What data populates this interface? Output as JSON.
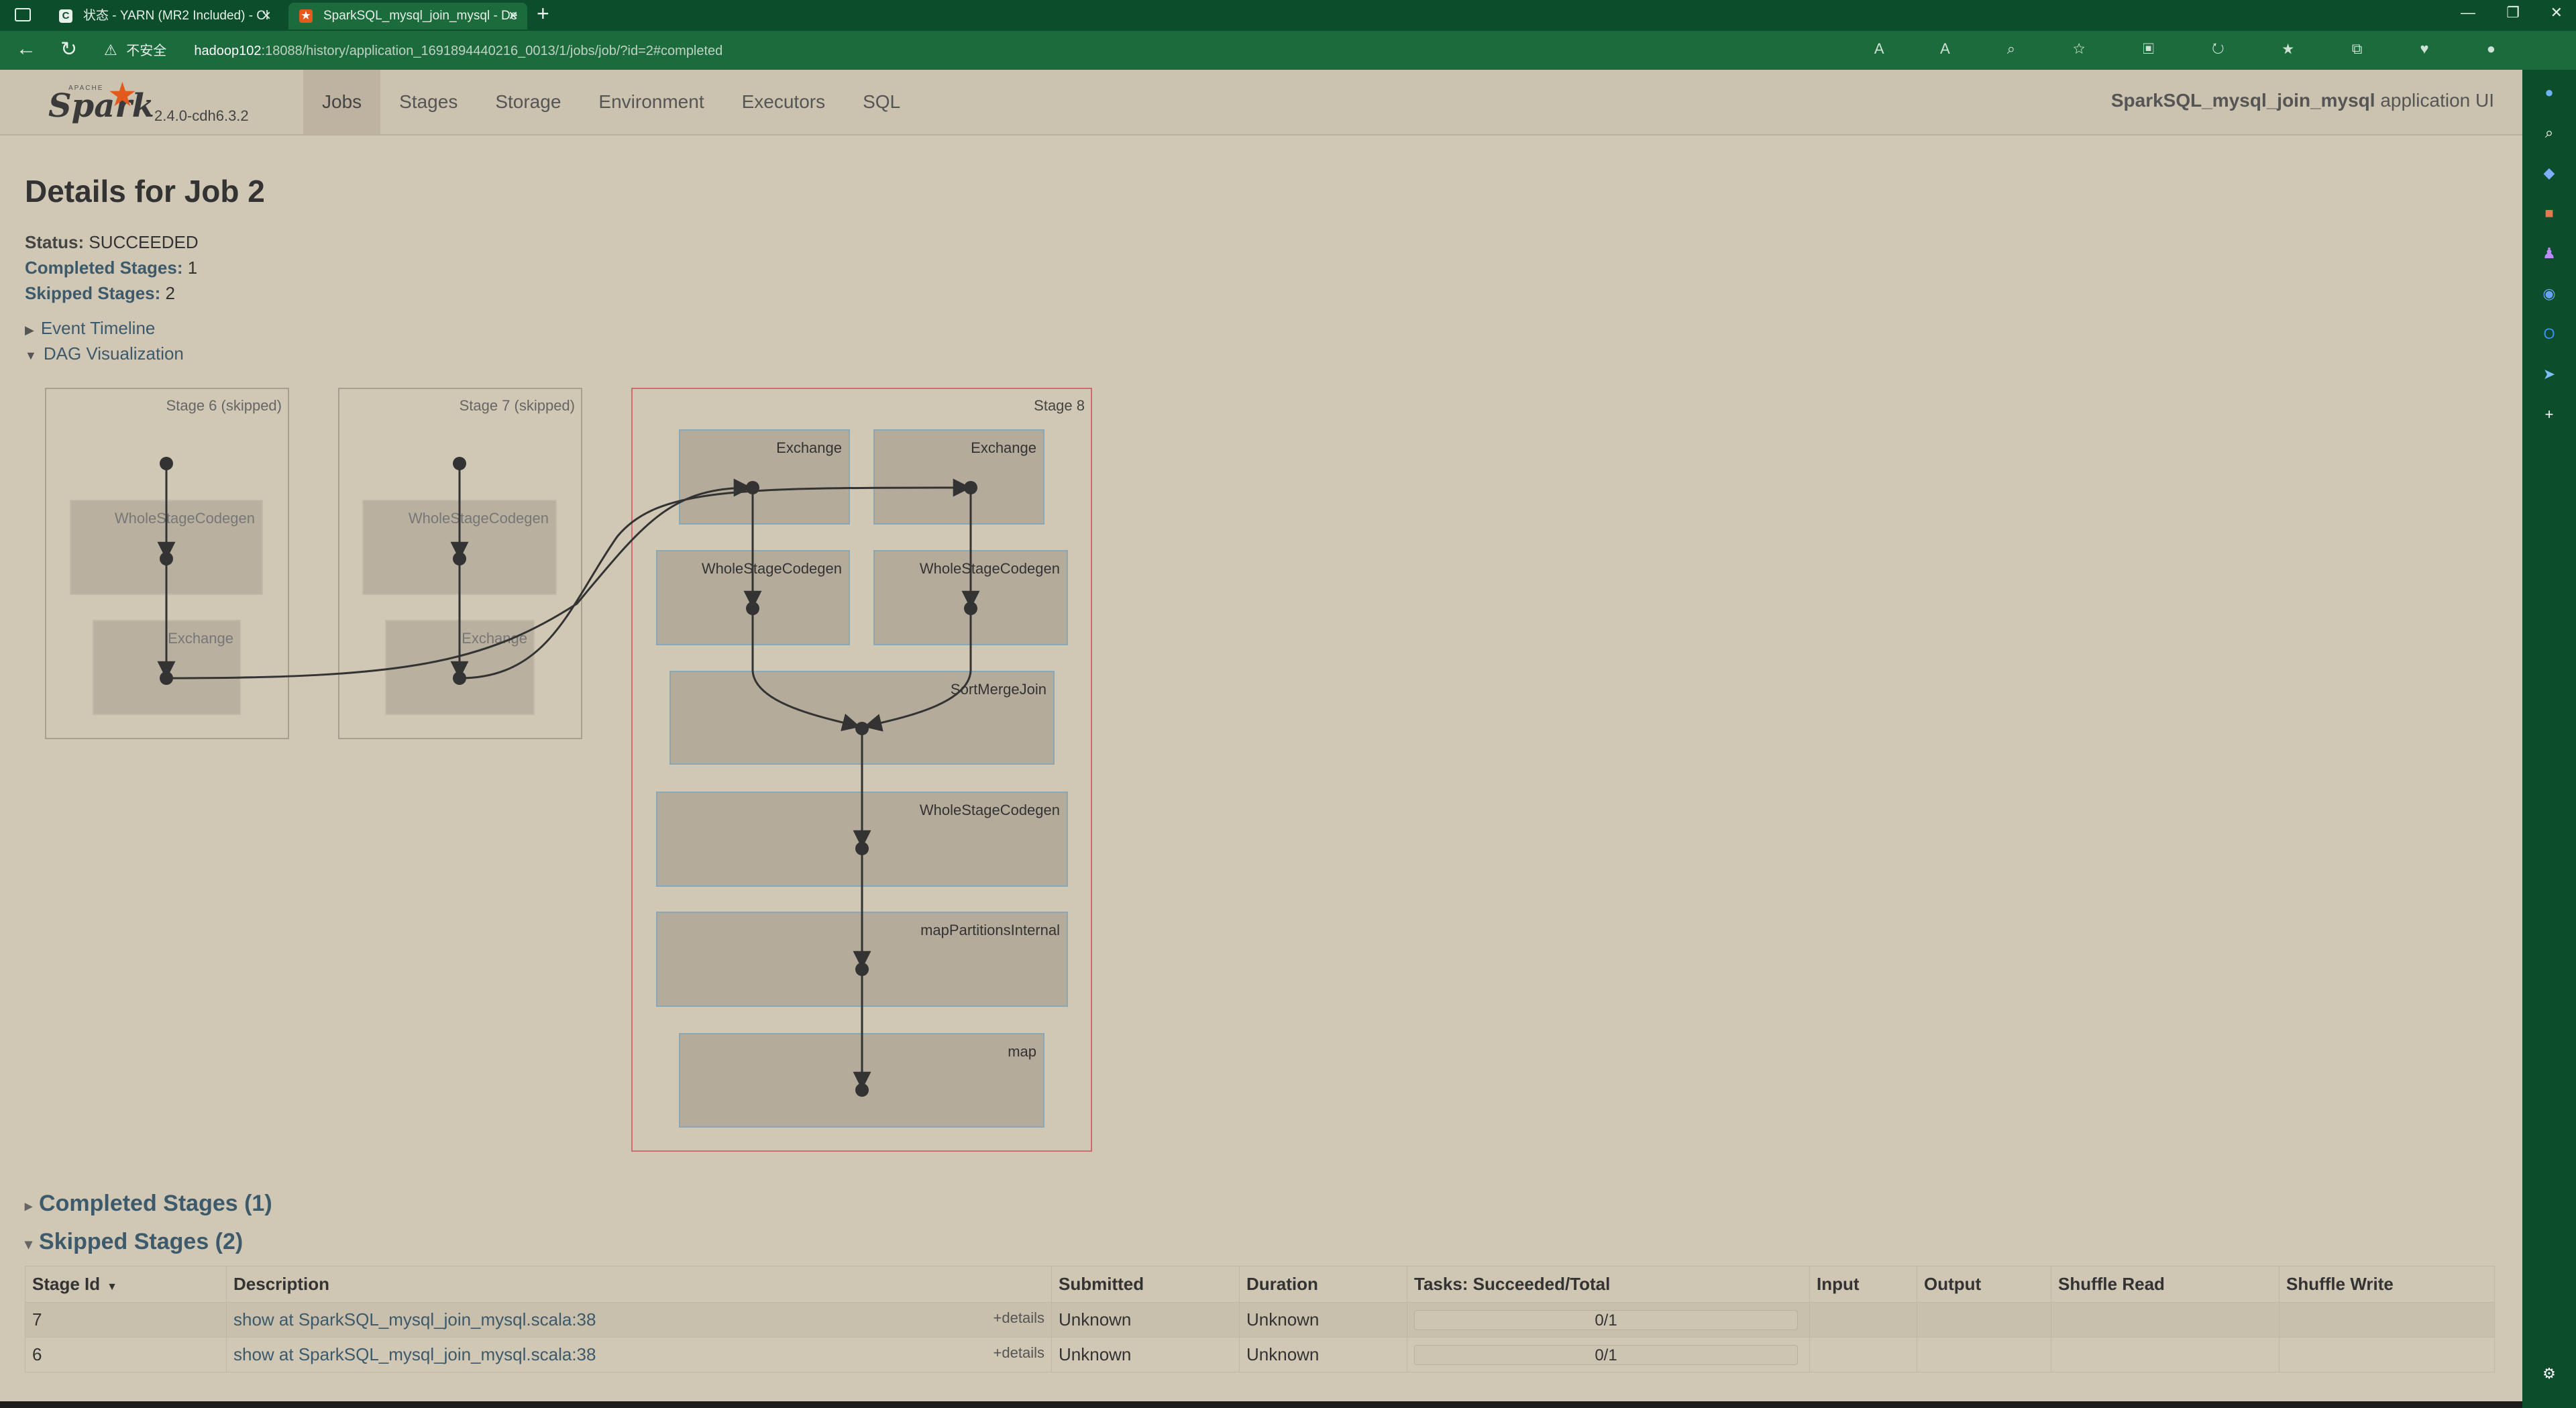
{
  "browser": {
    "tabs": [
      {
        "label": "状态 - YARN (MR2 Included) - Cl",
        "favicon": "C"
      },
      {
        "label": "SparkSQL_mysql_join_mysql - De",
        "favicon": "spark"
      }
    ],
    "new_tab": "+",
    "url": {
      "security": "不安全",
      "host": "hadoop102",
      "path": ":18088/history/application_1691894440216_0013/1/jobs/job/?id=2#completed"
    }
  },
  "spark_nav": {
    "logo_word": "Spark",
    "logo_apache": "APACHE",
    "version": "2.4.0-cdh6.3.2",
    "tabs": [
      "Jobs",
      "Stages",
      "Storage",
      "Environment",
      "Executors",
      "SQL"
    ],
    "active_tab": "Jobs",
    "app_name": "SparkSQL_mysql_join_mysql",
    "app_suffix": " application UI"
  },
  "job": {
    "title": "Details for Job 2",
    "status_label": "Status:",
    "status_value": "SUCCEEDED",
    "completed_label": "Completed Stages:",
    "completed_value": "1",
    "skipped_label": "Skipped Stages:",
    "skipped_value": "2",
    "event_timeline": "Event Timeline",
    "dag_visualization": "DAG Visualization"
  },
  "dag": {
    "stages": [
      {
        "label": "Stage 6 (skipped)",
        "ops": [
          "WholeStageCodegen",
          "Exchange"
        ]
      },
      {
        "label": "Stage 7 (skipped)",
        "ops": [
          "WholeStageCodegen",
          "Exchange"
        ]
      },
      {
        "label": "Stage 8",
        "ops": [
          "Exchange",
          "Exchange",
          "WholeStageCodegen",
          "WholeStageCodegen",
          "SortMergeJoin",
          "WholeStageCodegen",
          "mapPartitionsInternal",
          "map"
        ]
      }
    ]
  },
  "sections": {
    "completed": "Completed Stages (1)",
    "skipped": "Skipped Stages (2)"
  },
  "table": {
    "headers": [
      "Stage Id",
      "Description",
      "Submitted",
      "Duration",
      "Tasks: Succeeded/Total",
      "Input",
      "Output",
      "Shuffle Read",
      "Shuffle Write"
    ],
    "details_label": "+details",
    "rows": [
      {
        "id": "7",
        "description": "show at SparkSQL_mysql_join_mysql.scala:38",
        "submitted": "Unknown",
        "duration": "Unknown",
        "tasks": "0/1",
        "input": "",
        "output": "",
        "shuffle_read": "",
        "shuffle_write": ""
      },
      {
        "id": "6",
        "description": "show at SparkSQL_mysql_join_mysql.scala:38",
        "submitted": "Unknown",
        "duration": "Unknown",
        "tasks": "0/1",
        "input": "",
        "output": "",
        "shuffle_read": "",
        "shuffle_write": ""
      }
    ]
  }
}
